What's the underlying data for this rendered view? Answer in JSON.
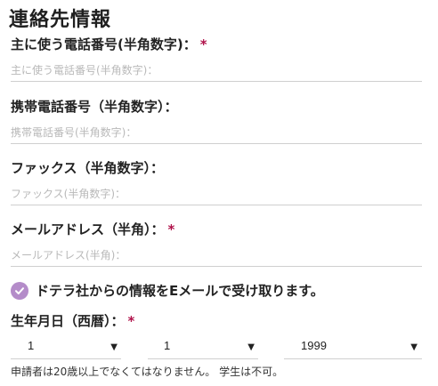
{
  "section_title": "連絡先情報",
  "required_symbol": "*",
  "fields": [
    {
      "label": "主に使う電話番号(半角数字)：",
      "placeholder": "主に使う電話番号(半角数字)：",
      "required": true
    },
    {
      "label": "携帯電話番号（半角数字）：",
      "placeholder": "携帯電話番号(半角数字)：",
      "required": false
    },
    {
      "label": "ファックス（半角数字）：",
      "placeholder": "ファックス(半角数字)：",
      "required": false
    },
    {
      "label": "メールアドレス（半角）：",
      "placeholder": "メールアドレス(半角)：",
      "required": true
    }
  ],
  "optin": {
    "label": "ドテラ社からの情報をEメールで受け取ります。",
    "checked": true,
    "icon": "checkmark-icon",
    "color": "#b48cc9"
  },
  "dob": {
    "label": "生年月日（西暦）：",
    "required": true,
    "month": "1",
    "day": "1",
    "year": "1999",
    "arrow": "▼"
  },
  "note": "申請者は20歳以上でなくてはなりません。 学生は不可。"
}
